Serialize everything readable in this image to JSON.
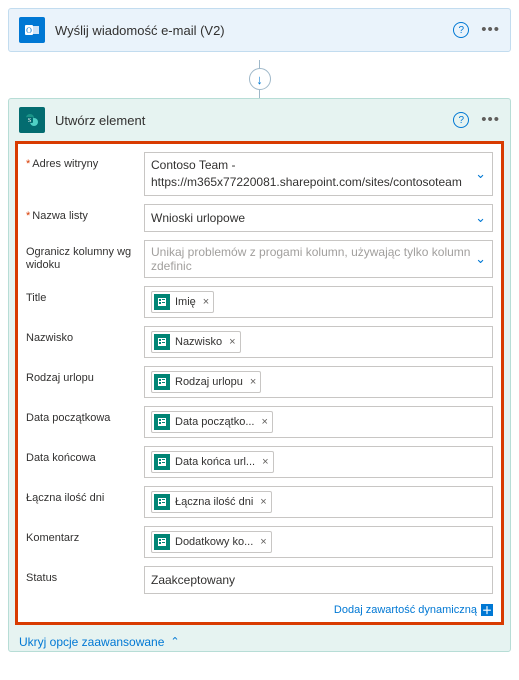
{
  "email_card": {
    "title": "Wyślij wiadomość e-mail (V2)"
  },
  "sp_card": {
    "title": "Utwórz element"
  },
  "form": {
    "site_label": "Adres witryny",
    "site_value": "Contoso Team - https://m365x77220081.sharepoint.com/sites/contosoteam",
    "list_label": "Nazwa listy",
    "list_value": "Wnioski urlopowe",
    "limit_label": "Ogranicz kolumny wg widoku",
    "limit_placeholder": "Unikaj problemów z progami kolumn, używając tylko kolumn zdefinic",
    "rows": [
      {
        "label": "Title",
        "token": "Imię"
      },
      {
        "label": "Nazwisko",
        "token": "Nazwisko"
      },
      {
        "label": "Rodzaj urlopu",
        "token": "Rodzaj urlopu"
      },
      {
        "label": "Data początkowa",
        "token": "Data początko..."
      },
      {
        "label": "Data końcowa",
        "token": "Data końca url..."
      },
      {
        "label": "Łączna ilość dni",
        "token": "Łączna ilość dni"
      },
      {
        "label": "Komentarz",
        "token": "Dodatkowy ko..."
      }
    ],
    "status_label": "Status",
    "status_value": "Zaakceptowany",
    "dynamic_link": "Dodaj zawartość dynamiczną",
    "hide_advanced": "Ukryj opcje zaawansowane"
  }
}
